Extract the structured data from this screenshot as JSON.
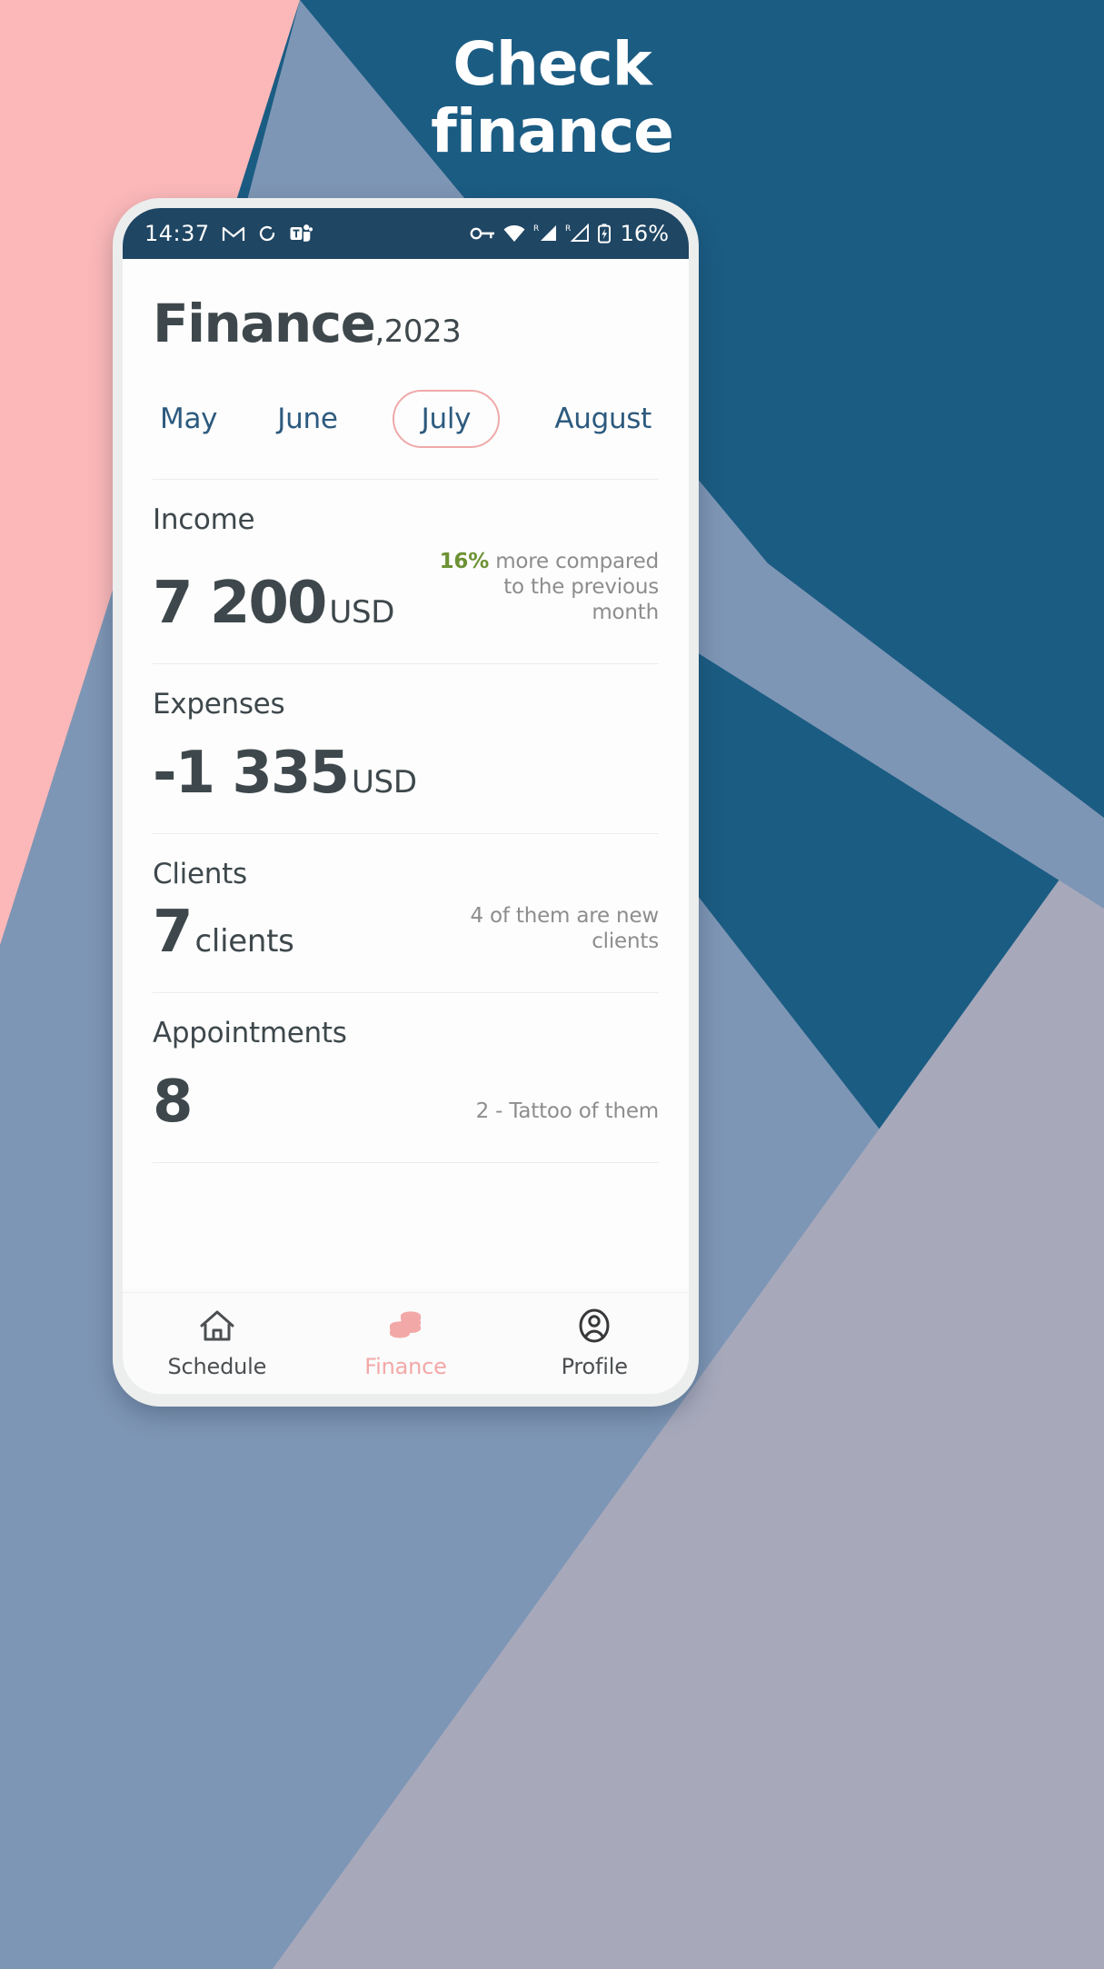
{
  "promo": {
    "line1": "Check",
    "line2": "finance"
  },
  "theme": {
    "bg_pink": "#fcb8b8",
    "bg_slate": "#7e96b5",
    "bg_teal": "#1b5c83",
    "bg_lavender": "#a7a9bb",
    "statusbar_bg": "#1f4663",
    "accent_pink": "#f0a9a9",
    "tab_blue": "#2d5a7e",
    "text_dark": "#3e484c",
    "text_muted": "#8d8d8d",
    "positive_green": "#6d9234"
  },
  "statusbar": {
    "time": "14:37",
    "battery_percent": "16%",
    "left_icons": [
      "gmail-icon",
      "sync-icon",
      "ms-teams-icon"
    ],
    "right_icons": [
      "vpn-key-icon",
      "wifi-icon",
      "signal-roaming-1-icon",
      "signal-roaming-2-icon",
      "battery-charging-icon"
    ],
    "roaming_label": "R"
  },
  "header": {
    "title": "Finance",
    "separator": ",",
    "year": "2023"
  },
  "months": [
    {
      "label": "May",
      "active": false
    },
    {
      "label": "June",
      "active": false
    },
    {
      "label": "July",
      "active": true
    },
    {
      "label": "August",
      "active": false
    }
  ],
  "metrics": [
    {
      "label": "Income",
      "value": "7 200",
      "unit": "USD",
      "note_highlight": "16%",
      "note_rest": " more compared to the previous month"
    },
    {
      "label": "Expenses",
      "value": "-1 335",
      "unit": "USD",
      "note_highlight": "",
      "note_rest": ""
    },
    {
      "label": "Clients",
      "value": "7",
      "unit": "clients",
      "note_highlight": "",
      "note_rest": "4 of them are new clients"
    },
    {
      "label": "Appointments",
      "value": "8",
      "unit": "",
      "note_highlight": "",
      "note_rest": "2 - Tattoo of them"
    }
  ],
  "nav": [
    {
      "label": "Schedule",
      "icon": "home-icon",
      "active": false
    },
    {
      "label": "Finance",
      "icon": "coins-icon",
      "active": true
    },
    {
      "label": "Profile",
      "icon": "person-circle-icon",
      "active": false
    }
  ]
}
